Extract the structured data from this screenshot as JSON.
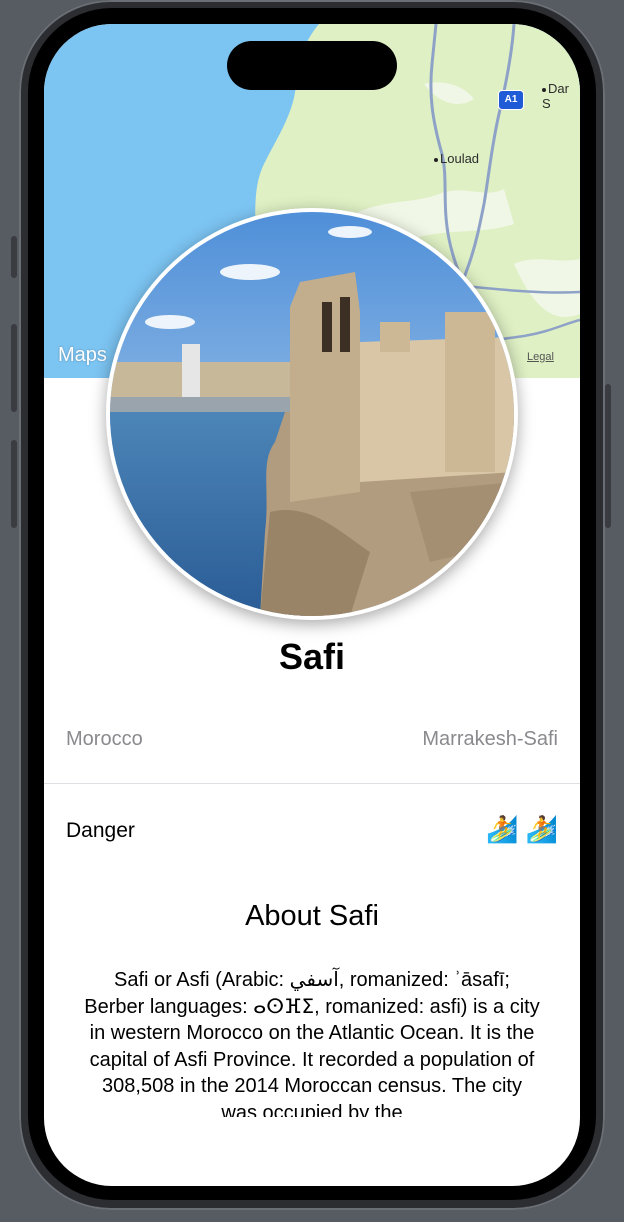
{
  "map": {
    "labels": {
      "loulad": "Loulad",
      "dar": "Dar S",
      "highway": "A1"
    },
    "attribution_logo": "Maps",
    "legal_link": "Legal",
    "colors": {
      "sea": "#7cc4f2",
      "land": "#dff0c4",
      "road": "#8ea2c8"
    }
  },
  "city": {
    "name": "Safi",
    "country": "Morocco",
    "region": "Marrakesh-Safi"
  },
  "danger": {
    "label": "Danger",
    "icons": "🏄 🏄",
    "level": 2
  },
  "about": {
    "title": "About Safi",
    "text": "Safi or Asfi (Arabic: آسفي, romanized: ʾāsafī; Berber languages: ⴰⵙⴼⵉ, romanized: asfi) is a city in western Morocco on the Atlantic Ocean. It is the capital of Asfi Province. It recorded a population of 308,508 in the 2014 Moroccan census. The city was occupied by the"
  }
}
